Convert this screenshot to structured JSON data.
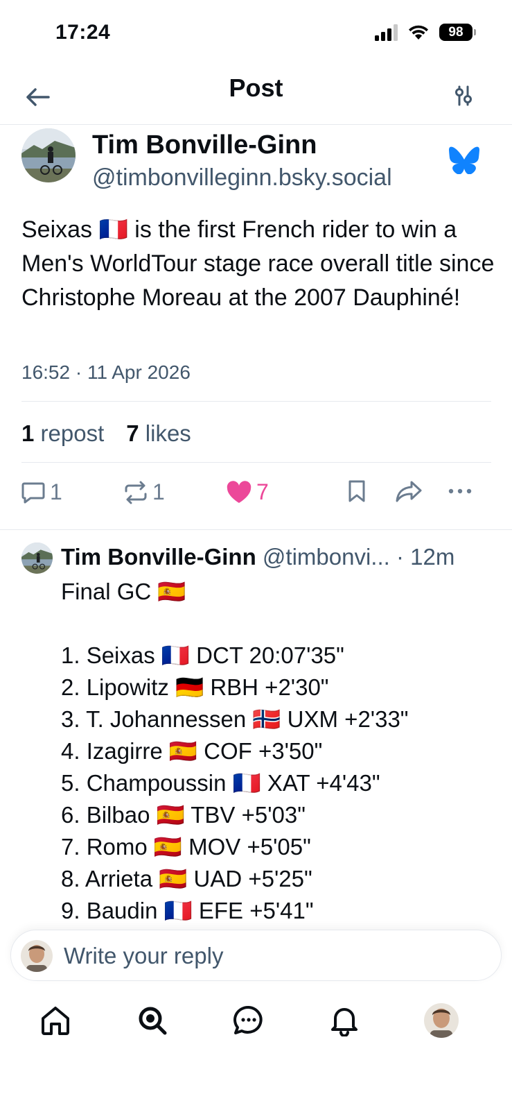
{
  "status_bar": {
    "time": "17:24",
    "battery": "98"
  },
  "header": {
    "title": "Post"
  },
  "post": {
    "author_name": "Tim Bonville-Ginn",
    "author_handle": "@timbonvilleginn.bsky.social",
    "text": "Seixas 🇫🇷 is the first French rider to win a Men's WorldTour stage race overall title since Christophe Moreau at the 2007 Dauphiné!",
    "timestamp": "16:52 · 11 Apr 2026",
    "stats": {
      "reposts_count": "1",
      "reposts_label": "repost",
      "likes_count": "7",
      "likes_label": "likes"
    },
    "actions": {
      "reply_count": "1",
      "repost_count": "1",
      "like_count": "7"
    }
  },
  "reply": {
    "author_name": "Tim Bonville-Ginn",
    "author_handle": "@timbonvi...",
    "time": "· 12m",
    "body": "Final GC 🇪🇸\n\n1. Seixas 🇫🇷 DCT 20:07'35\"\n2. Lipowitz 🇩🇪 RBH +2'30\"\n3. T. Johannessen 🇳🇴 UXM +2'33\"\n4. Izagirre 🇪🇸 COF +3'50\"\n5. Champoussin 🇫🇷 XAT +4'43\"\n6. Bilbao 🇪🇸 TBV +5'03\"\n7. Romo 🇪🇸 MOV +5'05\"\n8. Arrieta 🇪🇸 UAD +5'25\"\n9. Baudin 🇫🇷 EFE +5'41\""
  },
  "composer": {
    "placeholder": "Write your reply"
  },
  "icons": {
    "back": "arrow-left-icon",
    "filter": "sliders-icon",
    "badge": "bluesky-butterfly-icon",
    "reply": "speech-bubble-icon",
    "repost": "repost-icon",
    "like": "heart-icon",
    "bookmark": "bookmark-icon",
    "share": "share-arrow-icon",
    "more": "ellipsis-icon",
    "nav_home": "home-icon",
    "nav_search": "search-icon",
    "nav_chat": "chat-icon",
    "nav_notifications": "bell-icon"
  },
  "colors": {
    "accent_blue": "#1083fe",
    "like_pink": "#ec4899",
    "muted_text": "#42576c"
  }
}
